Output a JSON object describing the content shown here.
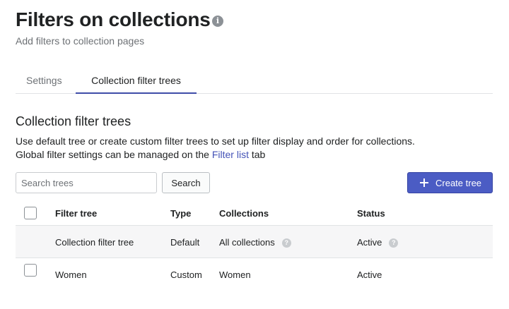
{
  "header": {
    "title": "Filters on collections",
    "subtitle": "Add filters to collection pages",
    "info_icon": "info-icon"
  },
  "tabs": [
    {
      "label": "Settings",
      "active": false
    },
    {
      "label": "Collection filter trees",
      "active": true
    }
  ],
  "section": {
    "title": "Collection filter trees",
    "description_line1": "Use default tree or create custom filter trees to set up filter display and order for collections.",
    "description_line2_prefix": "Global filter settings can be managed on the ",
    "description_link": "Filter list",
    "description_line2_suffix": " tab"
  },
  "toolbar": {
    "search_placeholder": "Search trees",
    "search_value": "",
    "search_label": "Search",
    "create_label": "Create tree",
    "create_icon": "plus-icon"
  },
  "table": {
    "columns": [
      "Filter tree",
      "Type",
      "Collections",
      "Status"
    ],
    "rows": [
      {
        "filter_tree": "Collection filter tree",
        "type": "Default",
        "collections": "All collections",
        "status": "Active",
        "has_checkbox": false,
        "help_icons": true
      },
      {
        "filter_tree": "Women",
        "type": "Custom",
        "collections": "Women",
        "status": "Active",
        "has_checkbox": true,
        "help_icons": false
      }
    ]
  },
  "colors": {
    "accent": "#4b5cc4",
    "link": "#4453b7",
    "tab_underline": "#3f4da8",
    "subdued_text": "#6d7175"
  }
}
